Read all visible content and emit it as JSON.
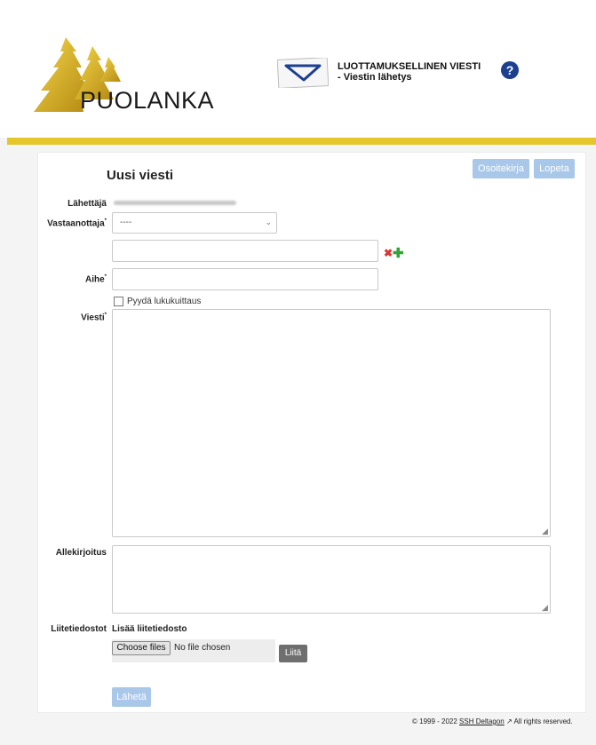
{
  "header": {
    "logo_text": "PUOLANKA",
    "title_line1": "LUOTTAMUKSELLINEN VIESTI",
    "title_line2": "- Viestin lähetys",
    "help_icon": "question-mark-icon"
  },
  "colors": {
    "accent_bar": "#e6c62a",
    "button_disabled": "#a9c7e8",
    "help_icon_bg": "#1c3f8f"
  },
  "form": {
    "heading": "Uusi viesti",
    "address_book_label": "Osoitekirja",
    "exit_label": "Lopeta",
    "sender_label": "Lähettäjä",
    "recipient_label": "Vastaanottaja",
    "recipient_value": "----",
    "subject_label": "Aihe",
    "read_receipt_label": "Pyydä lukukuittaus",
    "read_receipt_checked": false,
    "message_label": "Viesti",
    "signature_label": "Allekirjoitus",
    "attachments_label": "Liitetiedostot",
    "add_attachment_label": "Lisää liitetiedosto",
    "choose_files_label": "Choose files",
    "no_file_label": "No file chosen",
    "attach_button_label": "Liitä",
    "send_label": "Lähetä",
    "required_marker": "*"
  },
  "footer": {
    "copyright": "© 1999 - 2022 ",
    "link_text": "SSH Deltagon",
    "rights": " All rights reserved."
  }
}
